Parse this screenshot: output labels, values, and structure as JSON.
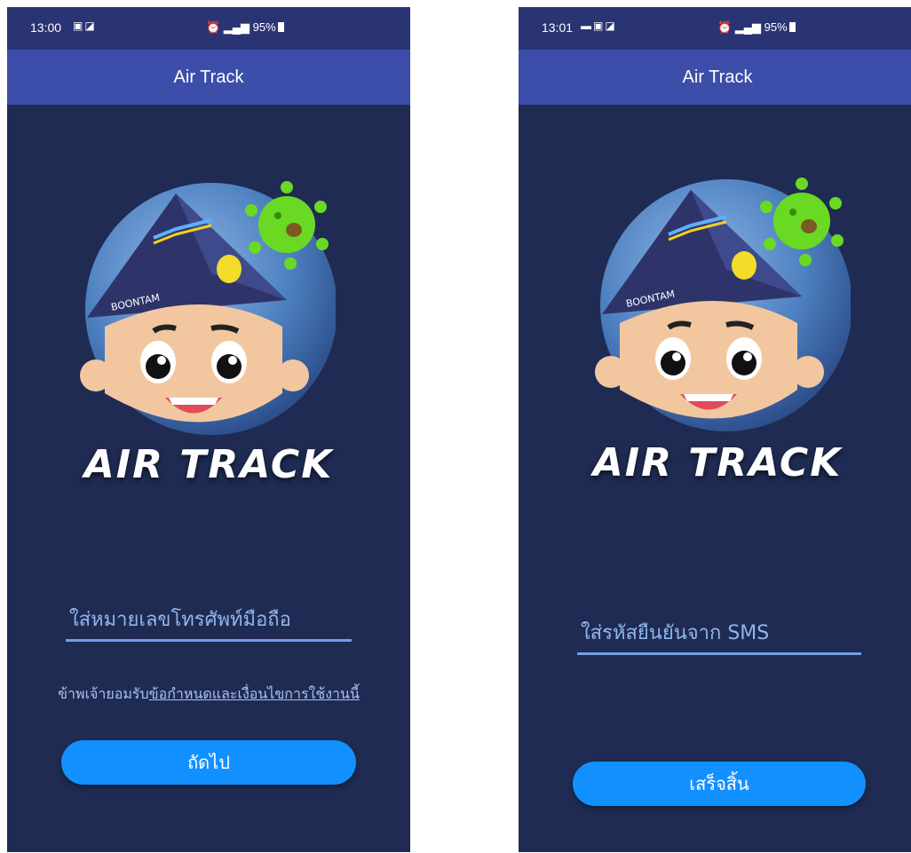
{
  "screens": [
    {
      "status": {
        "time": "13:00",
        "right": "95%"
      },
      "app_title": "Air Track",
      "brand": "AIR TRACK",
      "cap_text": "BOONTAM",
      "phone_input": {
        "placeholder": "ใส่หมายเลขโทรศัพท์มือถือ"
      },
      "terms": {
        "prefix": "ข้าพเจ้ายอมรับ",
        "link": "ข้อกำหนดและเงื่อนไขการใช้งานนี้"
      },
      "button": "ถัดไป"
    },
    {
      "status": {
        "time": "13:01",
        "right": "95%"
      },
      "app_title": "Air Track",
      "brand": "AIR TRACK",
      "cap_text": "BOONTAM",
      "otp_input": {
        "placeholder": "ใส่รหัสยืนยันจาก SMS"
      },
      "button": "เสร็จสิ้น"
    }
  ],
  "colors": {
    "background": "#1f2b52",
    "appbar": "#3c4eaa",
    "statusbar": "#2b3472",
    "button": "#1390ff",
    "underline": "#6fa1e8"
  },
  "icons": [
    "gallery-icon",
    "cast-icon",
    "alarm-icon",
    "signal-icon",
    "4g-icon",
    "battery-icon",
    "message-icon"
  ]
}
